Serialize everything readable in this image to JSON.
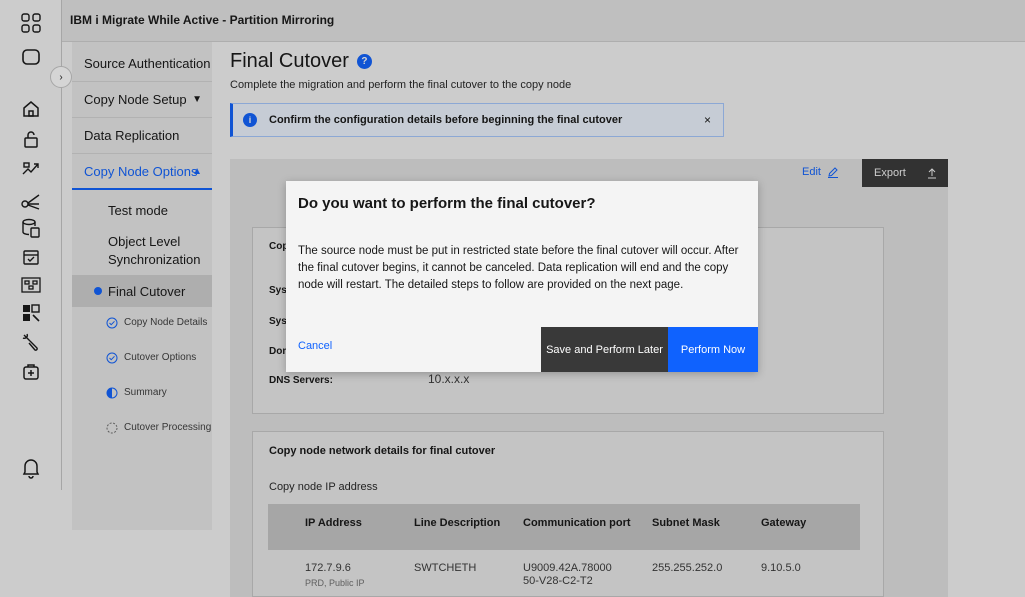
{
  "header": {
    "title": "IBM i Migrate While Active - Partition Mirroring"
  },
  "rail": {
    "expand_glyph": "›",
    "icons": [
      "apps-icon",
      "window-icon",
      "home-icon",
      "lock-icon",
      "migrate-icon",
      "network-icon",
      "storage-icon",
      "checklist-icon",
      "topology-icon",
      "dashboard-icon",
      "tools-icon",
      "health-icon",
      "notification-icon"
    ]
  },
  "nav": {
    "items": [
      {
        "label": "Source Authentication"
      },
      {
        "label": "Copy Node Setup",
        "chevron": "▼"
      },
      {
        "label": "Data Replication"
      },
      {
        "label": "Copy Node Options",
        "chevron": "▲"
      }
    ],
    "sub_items": [
      {
        "label": "Test mode"
      },
      {
        "label": "Object Level Synchronization"
      }
    ],
    "selected": "Final Cutover",
    "steps": [
      {
        "label": "Copy Node Details",
        "state": "complete"
      },
      {
        "label": "Cutover Options",
        "state": "complete"
      },
      {
        "label": "Summary",
        "state": "in-progress"
      },
      {
        "label": "Cutover Processing",
        "state": "not-started"
      }
    ]
  },
  "main": {
    "title": "Final Cutover",
    "help_glyph": "?",
    "subtitle": "Complete the migration and perform the final cutover to the copy node",
    "notification": {
      "icon_glyph": "i",
      "text": "Confirm the configuration details before beginning the final cutover",
      "close_glyph": "×"
    },
    "edit_label": "Edit",
    "export_label": "Export",
    "card1": {
      "labels": [
        "Cop",
        "Syst",
        "Syst",
        "Dom",
        "DNS Servers:"
      ],
      "dns_value": "10.x.x.x"
    },
    "card2": {
      "title": "Copy node network details for final cutover",
      "subtitle": "Copy node IP address",
      "columns": [
        "IP Address",
        "Line Description",
        "Communication port",
        "Subnet Mask",
        "Gateway"
      ],
      "row": {
        "ip": "172.7.9.6",
        "ip_sub": "PRD, Public IP",
        "line": "SWTCHETH",
        "port_1": "U9009.42A.78000",
        "port_2": "50-V28-C2-T2",
        "mask": "255.255.252.0",
        "gateway": "9.10.5.0"
      }
    }
  },
  "modal": {
    "title": "Do you want to perform the final cutover?",
    "body": "The source node must be put in restricted state before the final cutover will occur. After the final cutover begins, it cannot be canceled. Data replication will end and the copy node will restart. The detailed steps to follow are provided on the next page.",
    "cancel_label": "Cancel",
    "later_label": "Save and Perform Later",
    "now_label": "Perform Now"
  },
  "colors": {
    "accent": "#0f62fe",
    "dark_button": "#393939"
  }
}
